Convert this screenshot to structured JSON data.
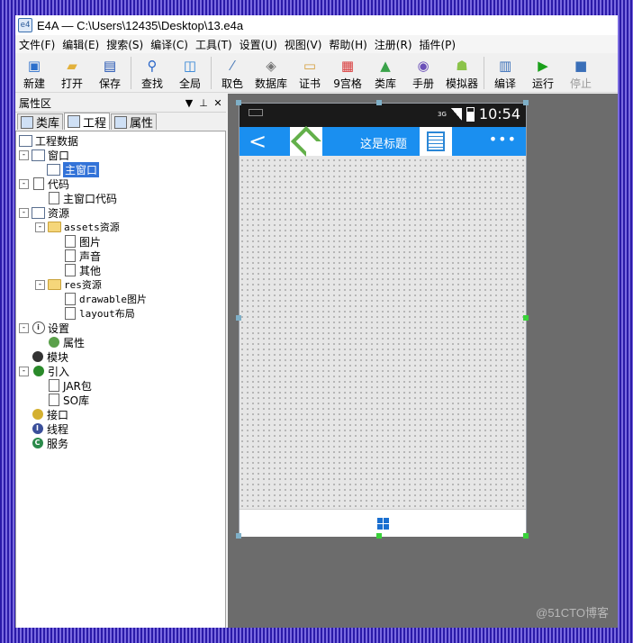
{
  "window": {
    "title": "E4A — C:\\Users\\12435\\Desktop\\13.e4a",
    "app_icon": "e4a-app-icon"
  },
  "menu": [
    "文件(F)",
    "编辑(E)",
    "搜索(S)",
    "编译(C)",
    "工具(T)",
    "设置(U)",
    "视图(V)",
    "帮助(H)",
    "注册(R)",
    "插件(P)"
  ],
  "toolbar": [
    {
      "label": "新建",
      "icon": "new-icon",
      "color": "#2c6fcb"
    },
    {
      "label": "打开",
      "icon": "open-folder-icon",
      "color": "#e2b13c"
    },
    {
      "label": "保存",
      "icon": "save-icon",
      "color": "#1d4fb0"
    },
    {
      "label": "查找",
      "icon": "find-icon",
      "color": "#2a66c8"
    },
    {
      "label": "全局",
      "icon": "global-icon",
      "color": "#2a7fd4"
    },
    {
      "label": "取色",
      "icon": "color-picker-icon",
      "color": "#4a7ab8"
    },
    {
      "label": "数据库",
      "icon": "database-icon",
      "color": "#777777"
    },
    {
      "label": "证书",
      "icon": "certificate-icon",
      "color": "#d6a040"
    },
    {
      "label": "9宫格",
      "icon": "nine-grid-icon",
      "color": "#d83a3a"
    },
    {
      "label": "类库",
      "icon": "library-icon",
      "color": "#3aa24a"
    },
    {
      "label": "手册",
      "icon": "manual-icon",
      "color": "#6a4fb8"
    },
    {
      "label": "模拟器",
      "icon": "android-icon",
      "color": "#8bc34a"
    },
    {
      "label": "编译",
      "icon": "compile-icon",
      "color": "#3a6fb8"
    },
    {
      "label": "运行",
      "icon": "run-icon",
      "color": "#1aa01a"
    },
    {
      "label": "停止",
      "icon": "stop-icon",
      "color": "#3a6fb8"
    }
  ],
  "panel": {
    "title": "属性区",
    "tabs": [
      {
        "label": "类库",
        "icon": "library-tab-icon"
      },
      {
        "label": "工程",
        "icon": "project-tab-icon"
      },
      {
        "label": "属性",
        "icon": "property-tab-icon"
      }
    ],
    "tree": [
      {
        "label": "工程数据",
        "icon": "project-icon",
        "exp": ""
      },
      {
        "label": "窗口",
        "icon": "window-icon",
        "exp": "-"
      },
      {
        "label": "主窗口",
        "icon": "window-icon",
        "exp": "",
        "selected": true
      },
      {
        "label": "代码",
        "icon": "code-icon",
        "exp": "-"
      },
      {
        "label": "主窗口代码",
        "icon": "document-icon",
        "exp": ""
      },
      {
        "label": "资源",
        "icon": "resource-icon",
        "exp": "-"
      },
      {
        "label": "assets资源",
        "icon": "folder-icon",
        "exp": "-"
      },
      {
        "label": "图片",
        "icon": "image-icon",
        "exp": ""
      },
      {
        "label": "声音",
        "icon": "music-note-icon",
        "exp": ""
      },
      {
        "label": "其他",
        "icon": "help-document-icon",
        "exp": ""
      },
      {
        "label": "res资源",
        "icon": "folder-icon",
        "exp": "-"
      },
      {
        "label": "drawable图片",
        "icon": "image-icon",
        "exp": ""
      },
      {
        "label": "layout布局",
        "icon": "layout-icon",
        "exp": ""
      },
      {
        "label": "设置",
        "icon": "info-icon",
        "exp": "-"
      },
      {
        "label": "属性",
        "icon": "gear-icon",
        "exp": ""
      },
      {
        "label": "模块",
        "icon": "module-icon",
        "exp": ""
      },
      {
        "label": "引入",
        "icon": "import-icon",
        "exp": "-"
      },
      {
        "label": "JAR包",
        "icon": "jar-icon",
        "exp": ""
      },
      {
        "label": "SO库",
        "icon": "so-library-icon",
        "exp": ""
      },
      {
        "label": "接口",
        "icon": "interface-icon",
        "exp": ""
      },
      {
        "label": "线程",
        "icon": "thread-icon",
        "exp": ""
      },
      {
        "label": "服务",
        "icon": "service-icon",
        "exp": ""
      }
    ]
  },
  "phone": {
    "time": "10:54",
    "network": "3G",
    "app_title": "这是标题",
    "back_glyph": "<",
    "more_glyph": "•••"
  },
  "watermark": "@51CTO博客",
  "colors": {
    "appbar": "#1a8ff0",
    "selection": "#3373d8",
    "canvas": "#6c6c6c"
  }
}
